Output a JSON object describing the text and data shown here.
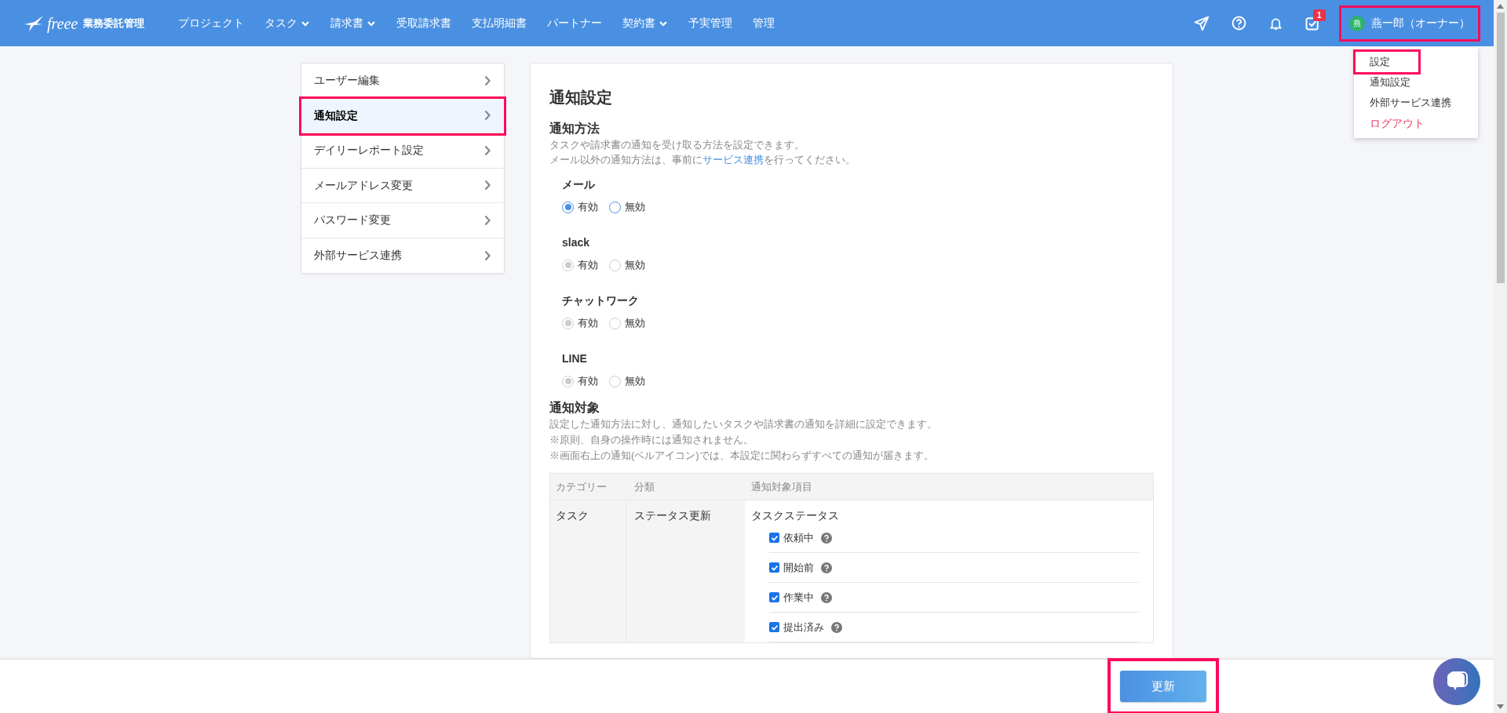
{
  "header": {
    "logo": {
      "brand": "freee",
      "product": "業務委託管理"
    },
    "nav": [
      {
        "label": "プロジェクト",
        "has_menu": false
      },
      {
        "label": "タスク",
        "has_menu": true
      },
      {
        "label": "請求書",
        "has_menu": true
      },
      {
        "label": "受取請求書",
        "has_menu": false
      },
      {
        "label": "支払明細書",
        "has_menu": false
      },
      {
        "label": "パートナー",
        "has_menu": false
      },
      {
        "label": "契約書",
        "has_menu": true
      },
      {
        "label": "予実管理",
        "has_menu": false
      },
      {
        "label": "管理",
        "has_menu": false
      }
    ],
    "task_badge": "1",
    "user": {
      "avatar": "燕",
      "name": "燕一郎（オーナー）",
      "highlighted": true
    }
  },
  "user_menu": [
    {
      "label": "設定",
      "highlighted": true,
      "danger": false
    },
    {
      "label": "通知設定",
      "highlighted": false,
      "danger": false
    },
    {
      "label": "外部サービス連携",
      "highlighted": false,
      "danger": false
    },
    {
      "label": "ログアウト",
      "highlighted": false,
      "danger": true
    }
  ],
  "sidebar": {
    "items": [
      {
        "label": "ユーザー編集",
        "selected": false,
        "highlighted": false
      },
      {
        "label": "通知設定",
        "selected": true,
        "highlighted": true
      },
      {
        "label": "デイリーレポート設定",
        "selected": false,
        "highlighted": false
      },
      {
        "label": "メールアドレス変更",
        "selected": false,
        "highlighted": false
      },
      {
        "label": "パスワード変更",
        "selected": false,
        "highlighted": false
      },
      {
        "label": "外部サービス連携",
        "selected": false,
        "highlighted": false
      }
    ]
  },
  "content": {
    "title": "通知設定",
    "methods": {
      "heading": "通知方法",
      "description": "タスクや請求書の通知を受け取る方法を設定できます。",
      "note": {
        "before": "メール以外の通知方法は、事前に",
        "link": "サービス連携",
        "after": "を行ってください。"
      },
      "channels": [
        {
          "name": "メール",
          "disabled": false,
          "options": [
            {
              "label": "有効",
              "selected": true
            },
            {
              "label": "無効",
              "selected": false
            }
          ]
        },
        {
          "name": "slack",
          "disabled": true,
          "options": [
            {
              "label": "有効",
              "selected": true
            },
            {
              "label": "無効",
              "selected": false
            }
          ]
        },
        {
          "name": "チャットワーク",
          "disabled": true,
          "options": [
            {
              "label": "有効",
              "selected": true
            },
            {
              "label": "無効",
              "selected": false
            }
          ]
        },
        {
          "name": "LINE",
          "disabled": true,
          "options": [
            {
              "label": "有効",
              "selected": true
            },
            {
              "label": "無効",
              "selected": false
            }
          ]
        }
      ]
    },
    "targets": {
      "heading": "通知対象",
      "notes": [
        "設定した通知方法に対し、通知したいタスクや請求書の通知を詳細に設定できます。",
        "※原則、自身の操作時には通知されません。",
        "※画面右上の通知(ベルアイコン)では、本設定に関わらずすべての通知が届きます。"
      ],
      "table": {
        "columns": [
          "カテゴリー",
          "分類",
          "通知対象項目"
        ],
        "rows": [
          {
            "category": "タスク",
            "classification": "ステータス更新",
            "group": "タスクステータス",
            "items": [
              {
                "label": "依頼中",
                "checked": true
              },
              {
                "label": "開始前",
                "checked": true
              },
              {
                "label": "作業中",
                "checked": true
              },
              {
                "label": "提出済み",
                "checked": true
              }
            ]
          }
        ]
      }
    }
  },
  "footer": {
    "update_button": {
      "label": "更新",
      "highlighted": true
    }
  }
}
